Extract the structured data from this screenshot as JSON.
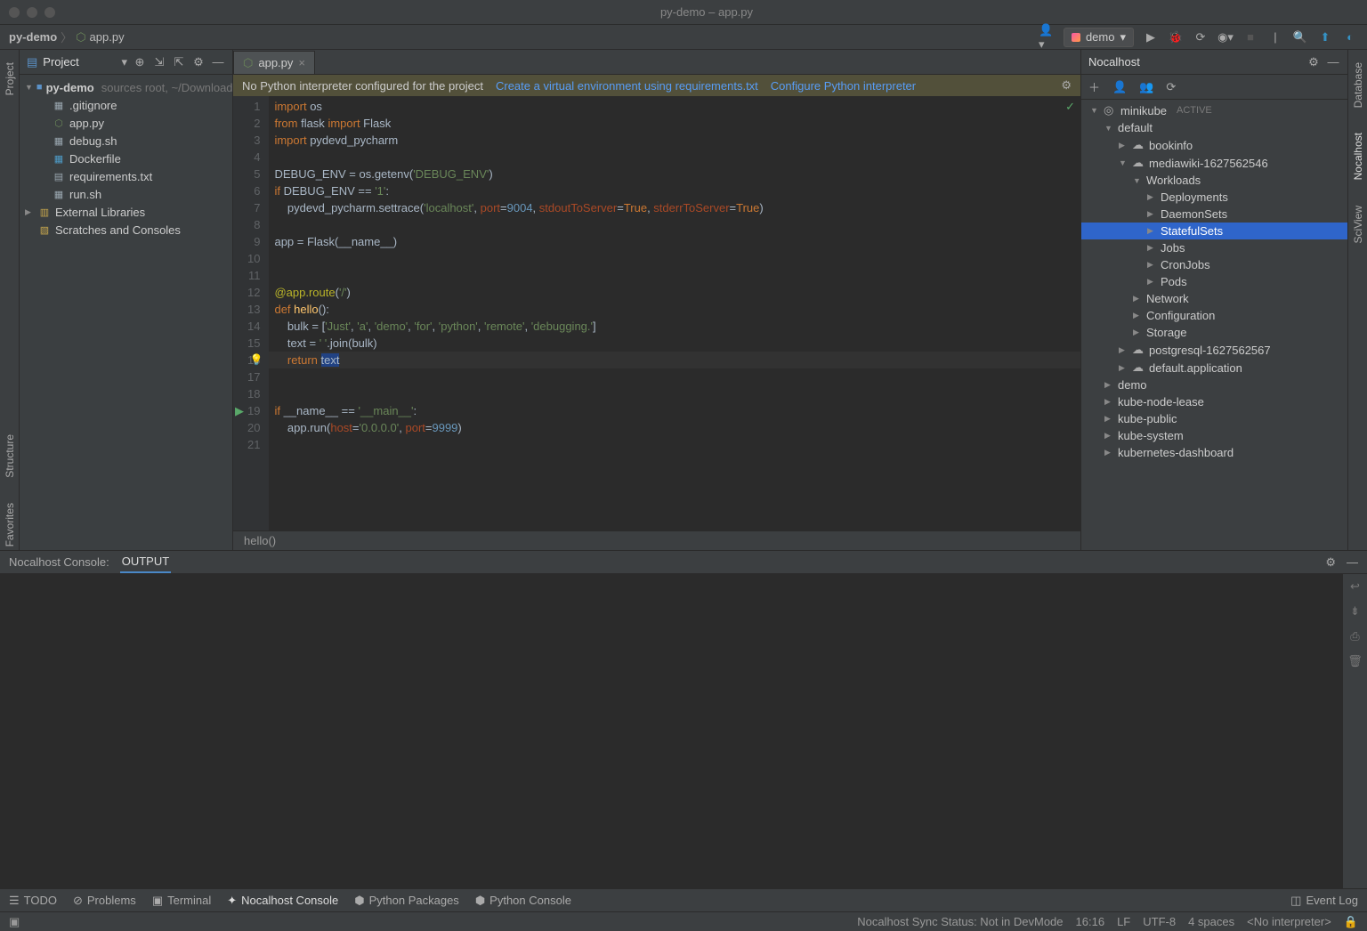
{
  "window_title": "py-demo – app.py",
  "breadcrumb": {
    "project": "py-demo",
    "file": "app.py"
  },
  "run_config": "demo",
  "left_tabs": [
    "Project",
    "Structure",
    "Favorites"
  ],
  "right_tabs": [
    "Database",
    "Nocalhost",
    "SciView"
  ],
  "project_panel": {
    "title": "Project",
    "root": {
      "name": "py-demo",
      "path": "sources root, ~/Downloads/p"
    },
    "files": [
      ".gitignore",
      "app.py",
      "debug.sh",
      "Dockerfile",
      "requirements.txt",
      "run.sh"
    ],
    "extra": [
      "External Libraries",
      "Scratches and Consoles"
    ]
  },
  "editor": {
    "tab": "app.py",
    "warning": {
      "msg": "No Python interpreter configured for the project",
      "link1": "Create a virtual environment using requirements.txt",
      "link2": "Configure Python interpreter"
    },
    "crumb": "hello()",
    "lines": [
      1,
      2,
      3,
      4,
      5,
      6,
      7,
      8,
      9,
      10,
      11,
      12,
      13,
      14,
      15,
      16,
      17,
      18,
      19,
      20,
      21
    ]
  },
  "nocalhost": {
    "title": "Nocalhost",
    "cluster": "minikube",
    "cluster_status": "ACTIVE",
    "ns_default": "default",
    "apps": [
      "bookinfo",
      "mediawiki-1627562546",
      "postgresql-1627562567",
      "default.application"
    ],
    "workloads_label": "Workloads",
    "workloads": [
      "Deployments",
      "DaemonSets",
      "StatefulSets",
      "Jobs",
      "CronJobs",
      "Pods"
    ],
    "groups": [
      "Network",
      "Configuration",
      "Storage"
    ],
    "namespaces": [
      "demo",
      "kube-node-lease",
      "kube-public",
      "kube-system",
      "kubernetes-dashboard"
    ]
  },
  "console": {
    "label": "Nocalhost Console:",
    "tabs": [
      "OUTPUT"
    ]
  },
  "bottom_toolbar": {
    "items": [
      "TODO",
      "Problems",
      "Terminal",
      "Nocalhost Console",
      "Python Packages",
      "Python Console"
    ],
    "event_log": "Event Log"
  },
  "status_bar": {
    "sync": "Nocalhost Sync Status: Not in DevMode",
    "pos": "16:16",
    "eol": "LF",
    "enc": "UTF-8",
    "indent": "4 spaces",
    "interp": "<No interpreter>"
  }
}
